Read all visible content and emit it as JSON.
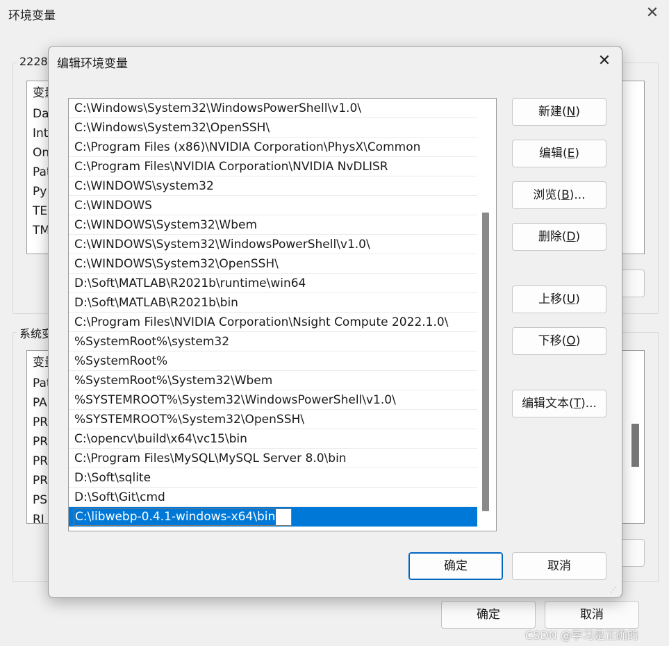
{
  "background_window": {
    "title": "环境变量",
    "user_group_label": "2228",
    "user_list_header": "变量",
    "user_rows": [
      "Da",
      "Int",
      "On",
      "Pat",
      "Py",
      "TE",
      "TM"
    ],
    "system_group_label": "系统变",
    "system_list_header": "变量",
    "system_rows": [
      "Pat",
      "PA",
      "PR",
      "PR",
      "PR",
      "PR",
      "PSI",
      "RI"
    ],
    "ok_label": "确定",
    "cancel_label": "取消"
  },
  "dialog": {
    "title": "编辑环境变量",
    "paths": [
      "C:\\Windows\\System32\\WindowsPowerShell\\v1.0\\",
      "C:\\Windows\\System32\\OpenSSH\\",
      "C:\\Program Files (x86)\\NVIDIA Corporation\\PhysX\\Common",
      "C:\\Program Files\\NVIDIA Corporation\\NVIDIA NvDLISR",
      "C:\\WINDOWS\\system32",
      "C:\\WINDOWS",
      "C:\\WINDOWS\\System32\\Wbem",
      "C:\\WINDOWS\\System32\\WindowsPowerShell\\v1.0\\",
      "C:\\WINDOWS\\System32\\OpenSSH\\",
      "D:\\Soft\\MATLAB\\R2021b\\runtime\\win64",
      "D:\\Soft\\MATLAB\\R2021b\\bin",
      "C:\\Program Files\\NVIDIA Corporation\\Nsight Compute 2022.1.0\\",
      "%SystemRoot%\\system32",
      "%SystemRoot%",
      "%SystemRoot%\\System32\\Wbem",
      "%SYSTEMROOT%\\System32\\WindowsPowerShell\\v1.0\\",
      "%SYSTEMROOT%\\System32\\OpenSSH\\",
      "C:\\opencv\\build\\x64\\vc15\\bin",
      "C:\\Program Files\\MySQL\\MySQL Server 8.0\\bin",
      "D:\\Soft\\sqlite",
      "D:\\Soft\\Git\\cmd"
    ],
    "editing_value": "C:\\libwebp-0.4.1-windows-x64\\bin",
    "buttons": {
      "new": {
        "text": "新建(",
        "key": "N",
        "tail": ")"
      },
      "edit": {
        "text": "编辑(",
        "key": "E",
        "tail": ")"
      },
      "browse": {
        "text": "浏览(",
        "key": "B",
        "tail": ")..."
      },
      "delete": {
        "text": "删除(",
        "key": "D",
        "tail": ")"
      },
      "move_up": {
        "text": "上移(",
        "key": "U",
        "tail": ")"
      },
      "move_down": {
        "text": "下移(",
        "key": "O",
        "tail": ")"
      },
      "edit_text": {
        "text": "编辑文本(",
        "key": "T",
        "tail": ")..."
      }
    },
    "ok_label": "确定",
    "cancel_label": "取消"
  },
  "watermark": "CSDN @学习是正确的",
  "colors": {
    "selection": "#0078d7",
    "default_button_border": "#0067c0"
  },
  "icons": {
    "close": "close-icon",
    "resize": "resize-grip-icon"
  }
}
